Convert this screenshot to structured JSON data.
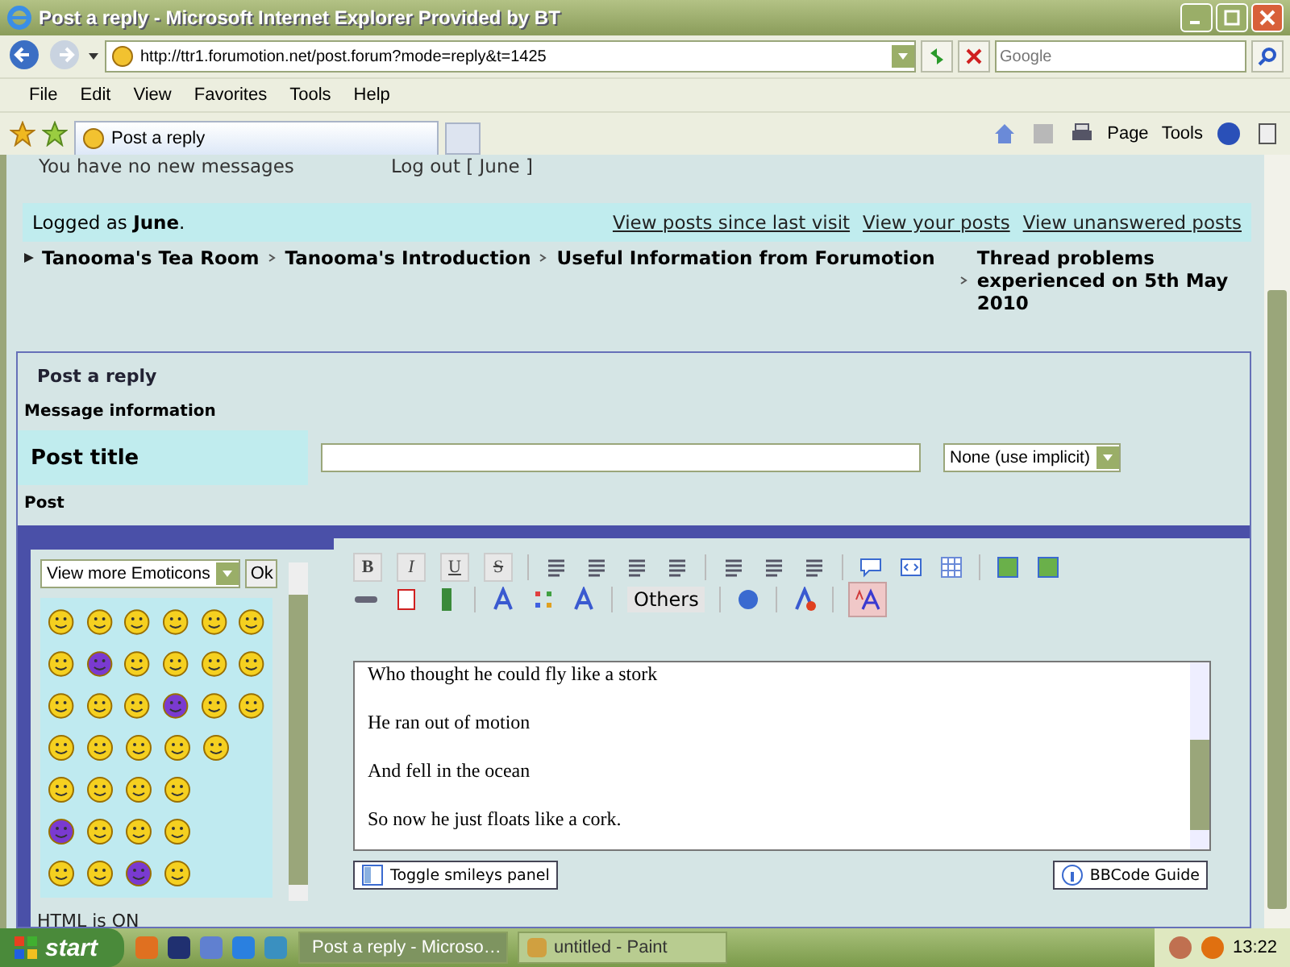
{
  "window": {
    "title": "Post a reply - Microsoft Internet Explorer Provided by BT"
  },
  "address_bar": {
    "url": "http://ttr1.forumotion.net/post.forum?mode=reply&t=1425"
  },
  "search": {
    "placeholder": "Google"
  },
  "menu": [
    "File",
    "Edit",
    "View",
    "Favorites",
    "Tools",
    "Help"
  ],
  "tabs": [
    {
      "label": "Post a reply",
      "selected": true
    }
  ],
  "command_bar": [
    "Page",
    "Tools"
  ],
  "page": {
    "top_links": [
      "You have no new messages",
      "Log out [ June ]"
    ],
    "logged_as": "Logged as **June**.",
    "quick_links": [
      "View posts since last visit",
      "View your posts",
      "View unanswered posts"
    ],
    "breadcrumbs": [
      "Tanooma's Tea Room",
      "Tanooma's Introduction",
      "Useful Information from Forumotion",
      "Thread problems experienced on 5th May 2010"
    ],
    "form": {
      "heading": "Post a reply",
      "section": "Message information",
      "title_label": "Post title",
      "icon_select": "None (use implicit)",
      "post_label": "Post",
      "emoticons_select": "View more Emoticons",
      "ok_button": "Ok",
      "html_status": "HTML is ON",
      "format_buttons": [
        "B",
        "I",
        "U",
        "S"
      ],
      "others_button": "Others",
      "mode_toggle": {
        "selected": true
      },
      "message_lines": [
        "Who thought he could fly like a stork",
        "He ran out of motion",
        "And fell in the ocean",
        "So now he just floats like a cork."
      ],
      "toggle_button": "Toggle smileys panel",
      "guide_button": "BBCode Guide"
    }
  },
  "taskbar": {
    "start": "start",
    "tasks": [
      {
        "label": "Post a reply - Microso…",
        "selected": true
      },
      {
        "label": "untitled - Paint",
        "selected": false
      }
    ],
    "clock": "13:22"
  }
}
